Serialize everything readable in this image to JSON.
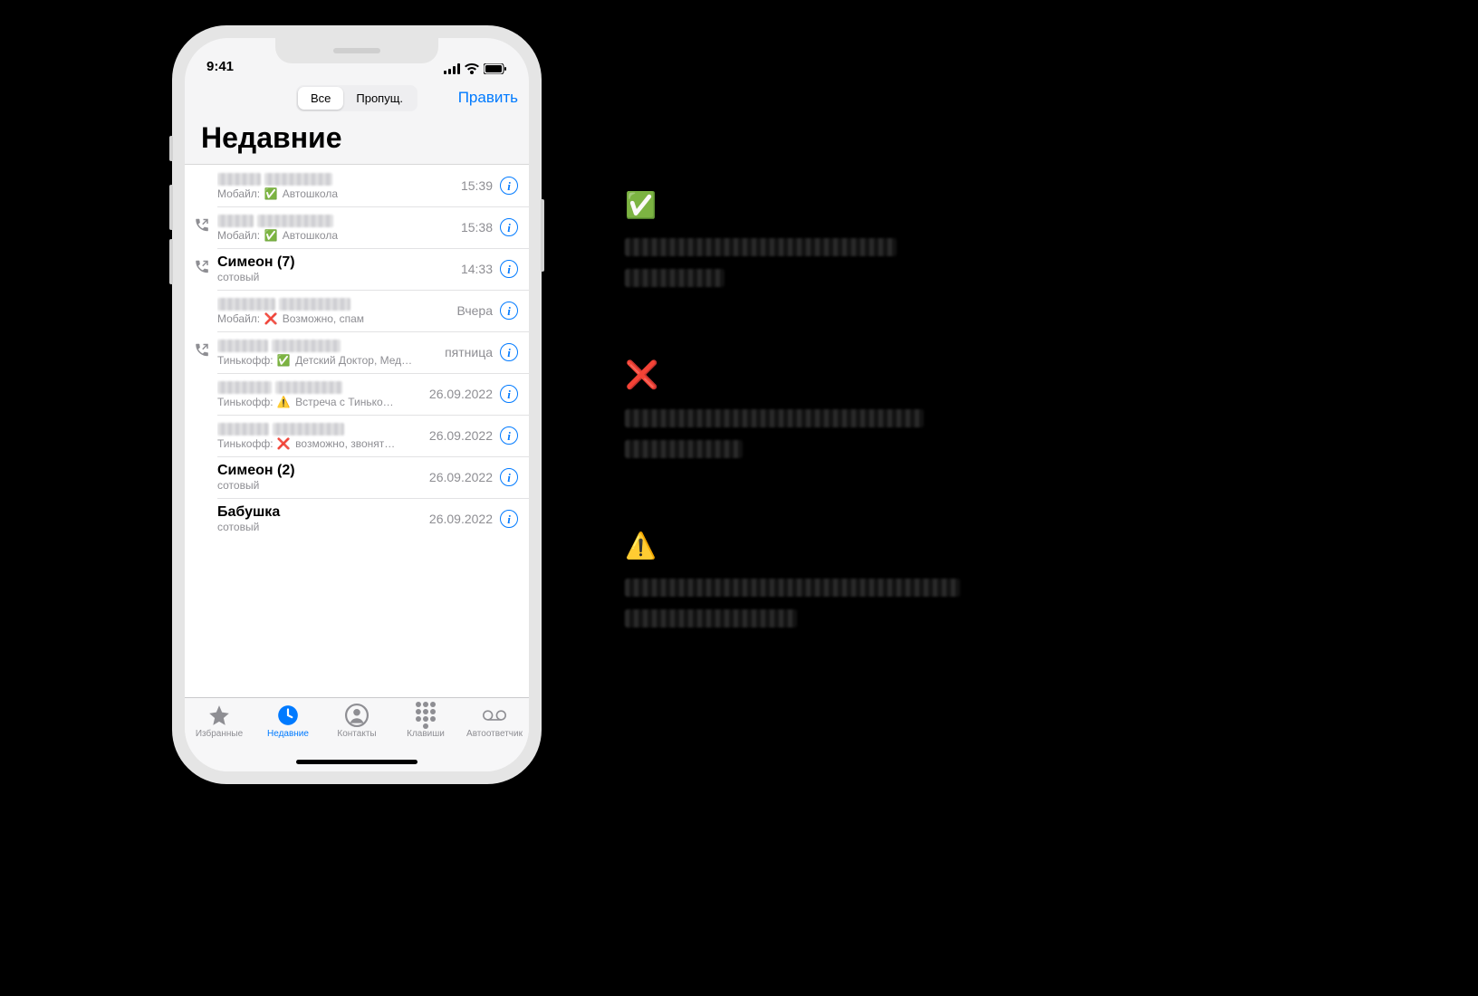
{
  "status_bar": {
    "time": "9:41"
  },
  "nav": {
    "segmented": {
      "all_label": "Все",
      "missed_label": "Пропущ.",
      "active": "all"
    },
    "edit_label": "Править"
  },
  "title": "Недавние",
  "calls": [
    {
      "name_blurred": true,
      "name": "",
      "bold": false,
      "outgoing": false,
      "sub_prefix": "Мобайл:",
      "mark": "✅",
      "sub_text": "Автошкола",
      "time": "15:39"
    },
    {
      "name_blurred": true,
      "name": "",
      "bold": false,
      "outgoing": true,
      "sub_prefix": "Мобайл:",
      "mark": "✅",
      "sub_text": "Автошкола",
      "time": "15:38"
    },
    {
      "name_blurred": false,
      "name": "Симеон (7)",
      "bold": true,
      "outgoing": true,
      "sub_prefix": "сотовый",
      "mark": "",
      "sub_text": "",
      "time": "14:33"
    },
    {
      "name_blurred": true,
      "name": "",
      "bold": false,
      "outgoing": false,
      "sub_prefix": "Мобайл:",
      "mark": "❌",
      "sub_text": "Возможно, спам",
      "time": "Вчера"
    },
    {
      "name_blurred": true,
      "name": "",
      "bold": false,
      "outgoing": true,
      "sub_prefix": "Тинькофф:",
      "mark": "✅",
      "sub_text": "Детский Доктор, Мед…",
      "time": "пятница"
    },
    {
      "name_blurred": true,
      "name": "",
      "bold": false,
      "outgoing": false,
      "sub_prefix": "Тинькофф:",
      "mark": "⚠️",
      "sub_text": "Встреча с Тинько…",
      "time": "26.09.2022"
    },
    {
      "name_blurred": true,
      "name": "",
      "bold": false,
      "outgoing": false,
      "sub_prefix": "Тинькофф:",
      "mark": "❌",
      "sub_text": "возможно, звонят…",
      "time": "26.09.2022"
    },
    {
      "name_blurred": false,
      "name": "Симеон (2)",
      "bold": true,
      "outgoing": false,
      "sub_prefix": "сотовый",
      "mark": "",
      "sub_text": "",
      "time": "26.09.2022"
    },
    {
      "name_blurred": false,
      "name": "Бабушка",
      "bold": true,
      "outgoing": false,
      "sub_prefix": "сотовый",
      "mark": "",
      "sub_text": "",
      "time": "26.09.2022"
    }
  ],
  "tabs": {
    "favorites": "Избранные",
    "recents": "Недавние",
    "contacts": "Контакты",
    "keypad": "Клавиши",
    "voicemail": "Автоответчик",
    "active": "recents"
  },
  "legend": [
    {
      "mark": "✅",
      "line_widths": [
        300,
        110
      ]
    },
    {
      "mark": "❌",
      "line_widths": [
        330,
        130
      ]
    },
    {
      "mark": "⚠️",
      "line_widths": [
        370,
        190
      ]
    }
  ]
}
